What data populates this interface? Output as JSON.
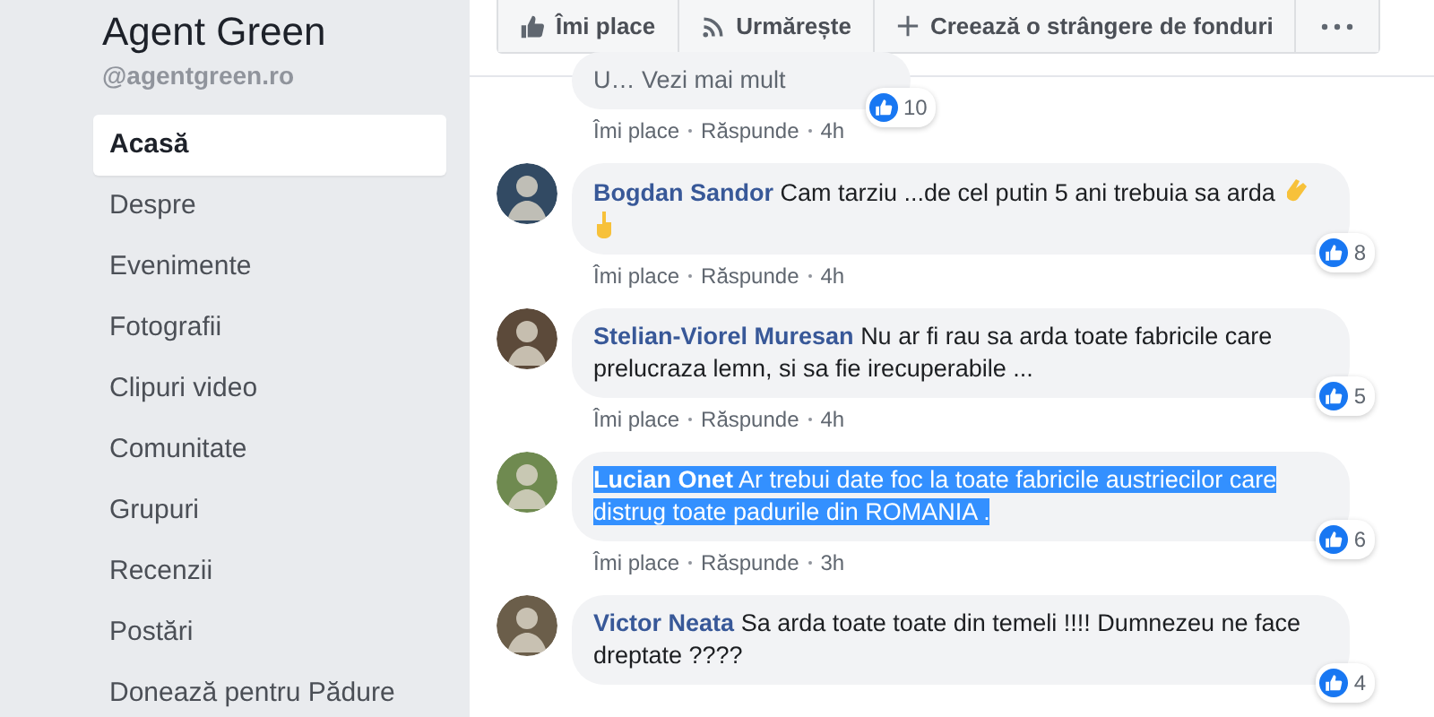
{
  "sidebar": {
    "page_name": "Agent Green",
    "handle": "@agentgreen.ro",
    "items": [
      {
        "label": "Acasă",
        "selected": true
      },
      {
        "label": "Despre",
        "selected": false
      },
      {
        "label": "Evenimente",
        "selected": false
      },
      {
        "label": "Fotografii",
        "selected": false
      },
      {
        "label": "Clipuri video",
        "selected": false
      },
      {
        "label": "Comunitate",
        "selected": false
      },
      {
        "label": "Grupuri",
        "selected": false
      },
      {
        "label": "Recenzii",
        "selected": false
      },
      {
        "label": "Postări",
        "selected": false
      },
      {
        "label": "Donează pentru Pădure",
        "selected": false
      }
    ]
  },
  "page_actions": [
    {
      "kind": "like",
      "label": "Îmi place"
    },
    {
      "kind": "follow",
      "label": "Urmărește"
    },
    {
      "kind": "fundraiser",
      "label": "Creează o strângere de fonduri"
    },
    {
      "kind": "more"
    }
  ],
  "comments": [
    {
      "kind": "partial",
      "text": "U…",
      "link": "Vezi mai mult",
      "actions": [
        "Îmi place",
        "Răspunde",
        "4h"
      ],
      "like_count": "10"
    },
    {
      "kind": "full",
      "author": "Bogdan Sandor",
      "text": "Cam tarziu ...de cel putin 5 ani trebuia sa arda",
      "emoji": true,
      "actions": [
        "Îmi place",
        "Răspunde",
        "4h"
      ],
      "like_count": "8",
      "highlighted": false
    },
    {
      "kind": "full",
      "author": "Stelian-Viorel Muresan",
      "text": "Nu ar fi rau sa arda toate fabricile care prelucraza lemn, si sa fie irecuperabile ...",
      "actions": [
        "Îmi place",
        "Răspunde",
        "4h"
      ],
      "like_count": "5",
      "highlighted": false
    },
    {
      "kind": "full",
      "author": "Lucian Onet",
      "text": "Ar trebui date foc la toate fabricile austriecilor care distrug toate padurile din ROMANIA .",
      "actions": [
        "Îmi place",
        "Răspunde",
        "3h"
      ],
      "like_count": "6",
      "highlighted": true
    },
    {
      "kind": "full",
      "author": "Victor Neata",
      "text": "Sa arda toate toate din temeli !!!! Dumnezeu ne face dreptate ????",
      "like_count": "4",
      "highlighted": false
    }
  ]
}
